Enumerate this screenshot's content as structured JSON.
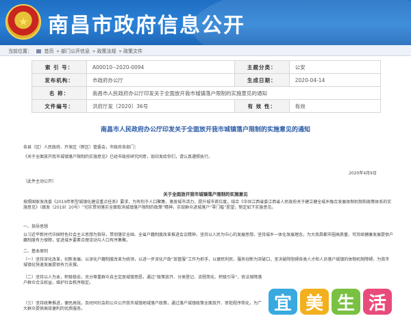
{
  "site": {
    "title": "南昌市政府信息公开"
  },
  "breadcrumb": {
    "label": "当前位置：",
    "items": [
      "首页",
      "部门公开信息",
      "政策法规",
      "政策文件"
    ]
  },
  "meta": {
    "rows": [
      {
        "k1": "索 引 号：",
        "v1": "A00010--2020-0094",
        "k2": "主题分类：",
        "v2": "公安"
      },
      {
        "k1": "发布机构：",
        "v1": "市政府办公厅",
        "k2": "生成日期：",
        "v2": "2020-04-14"
      }
    ],
    "name_label": "名      称：",
    "name_value": "南昌市人民政府办公厅印发关于全面放开我市城镇落户限制的实施意见的通知",
    "doc_label": "文件编号：",
    "doc_value": "洪府厅发〔2020〕36号",
    "valid_label": "有 效 性：",
    "valid_value": "有效"
  },
  "doc": {
    "title": "南昌市人民政府办公厅印发关于全面放开我市城镇落户限制的实施意见的通知",
    "salutation": "各县（区）人民政府、开发区（新区）管委会，市政府各部门：",
    "intro": "《关于全面放开我市城镇落户限制的实施意见》已经市政府研究同意，现印发给你们，请认真遵照执行。",
    "date": "2020年4月9日",
    "note": "（此件主动公开）",
    "sub_title": "关于全面放开我市城镇落户限制的实施意见",
    "para1": "按照国家发改委《2019年新型城镇化建设重点任务》要求，为有利于人口聚集，激发城市活力，提升城市首位度，结合《中共江西省委江西省人民政府关于建立健全城乡融合发展体制机制和政策体系的实施意见》（赣发〔2019〕20号）“切实贯彻落实全面取消城镇落户限制的政策”精神，实现群众进城落户“零门槛”愿望，制定如下实施意见。",
    "sec1": "一、指导思想",
    "para2": "以习近平新时代中国特色社会主义思想为指导，贯彻落实全国、全省户籍制度改革推进会议精神，坚持以人民为中心的发展思想，坚持城乡一体化发展理念，为大南昌都市圈高质量、可持续健康发展提供户籍制度有力保障，促进城乡要素合理流动与人口有序集聚。",
    "sec2": "二、基本原则",
    "para3": "（一）坚持深化改革，创新发展。以深化户籍制度改革为统领，以进一步深化户政“放管服”工作为抓手，以便民利民、服务创新为突破口，坚决破除阻碍各类人才和人员落户城镇的体制机制障碍，为我市城镇化快速发展提供有力支撑。",
    "para4": "（二）坚持以人为本，积极稳妥。充分尊重群众自主定居城镇意愿，通过“政策放开、分类登记、流程简化、积极引导”，依法保障落户群众合法权益，维护社会秩序稳定。",
    "para5": "（三）坚持统筹推进，便民高效。及时同社会和公众公开我市城镇地域落户政策，通过落户城镇政策全面放开、审批程序简化，为广大群众提供高效便利的优质服务。"
  },
  "watermark": {
    "chars": [
      "宜",
      "美",
      "生",
      "活"
    ]
  }
}
